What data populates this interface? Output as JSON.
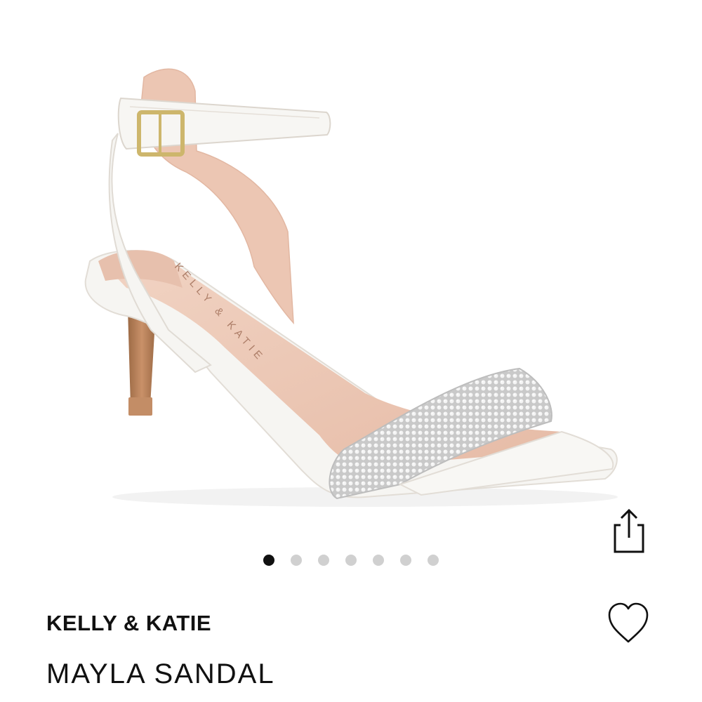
{
  "product": {
    "brand": "KELLY & KATIE",
    "name": "MAYLA SANDAL",
    "insole_logo_text": "KELLY & KATIE"
  },
  "gallery": {
    "image_count": 7,
    "active_index": 0
  },
  "icons": {
    "share": "share-icon",
    "favorite": "heart-outline-icon"
  },
  "colors": {
    "active_dot": "#111111",
    "inactive_dot": "#d0d0d0",
    "sandal_white": "#f5f5f3",
    "lining": "#ecc9b7",
    "heel": "#b98357",
    "buckle_gold": "#cdb66c"
  }
}
